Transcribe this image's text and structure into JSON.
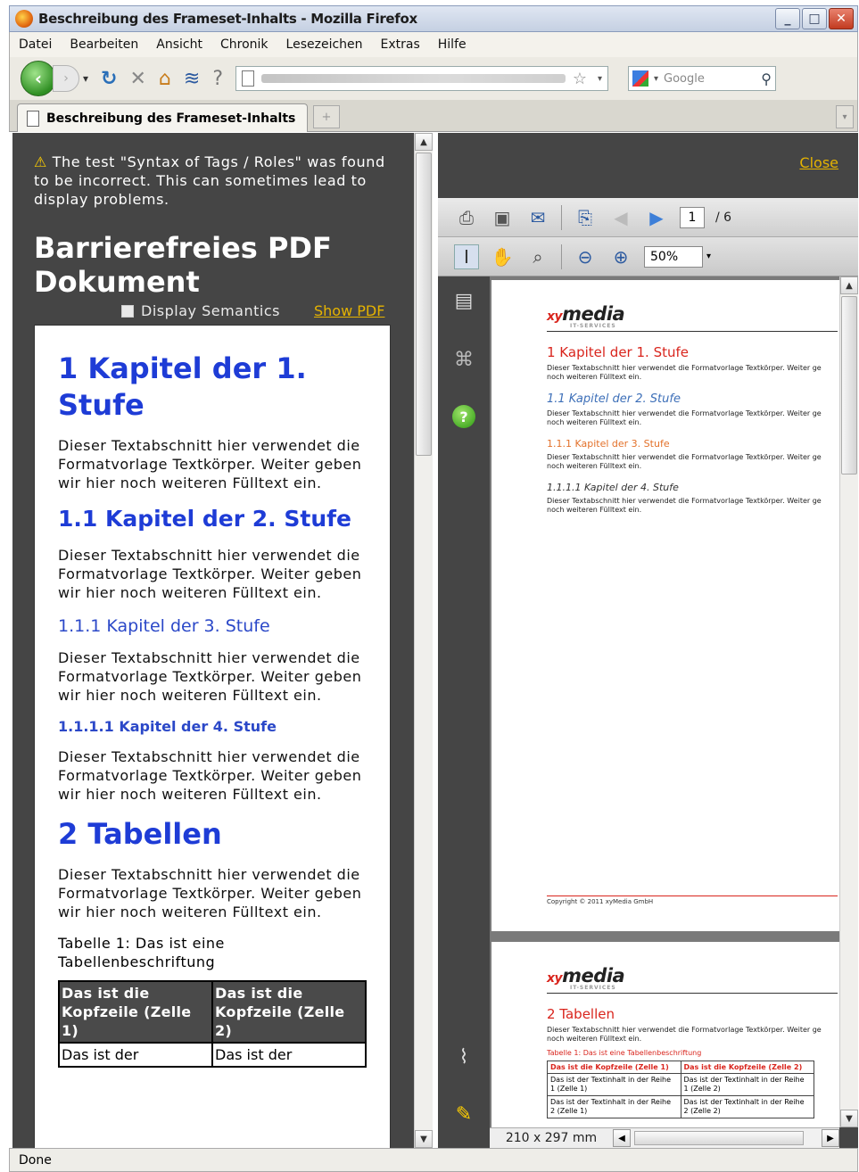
{
  "window": {
    "title": "Beschreibung des Frameset-Inhalts - Mozilla Firefox",
    "controls": [
      "_",
      "□",
      "✕"
    ]
  },
  "menu": [
    "Datei",
    "Bearbeiten",
    "Ansicht",
    "Chronik",
    "Lesezeichen",
    "Extras",
    "Hilfe"
  ],
  "navbar": {
    "search_placeholder": "Google",
    "icons": [
      "back-arrow-icon",
      "forward-arrow-icon",
      "reload-icon",
      "stop-icon",
      "home-icon",
      "rss-icon",
      "help-icon"
    ]
  },
  "tabs": [
    {
      "label": "Beschreibung des Frameset-Inhalts"
    }
  ],
  "left_frame": {
    "warning": "The test \"Syntax of Tags / Roles\" was found to be incorrect. This can sometimes lead to display problems.",
    "title": "Barrierefreies PDF Dokument",
    "display_semantics": "Display Semantics",
    "show_pdf": "Show PDF",
    "doc": {
      "h1_1": "1 Kapitel der 1. Stufe",
      "p1": "Dieser Textabschnitt hier verwendet die Formatvorlage Textkörper. Weiter geben wir hier noch weiteren Fülltext ein.",
      "h2_1": "1.1 Kapitel der 2. Stufe",
      "p2": "Dieser Textabschnitt hier verwendet die Formatvorlage Textkörper. Weiter geben wir hier noch weiteren Fülltext ein.",
      "h3_1": "1.1.1 Kapitel der 3. Stufe",
      "p3": "Dieser Textabschnitt hier verwendet die Formatvorlage Textkörper. Weiter geben wir hier noch weiteren Fülltext ein.",
      "h4_1": "1.1.1.1 Kapitel der 4. Stufe",
      "p4": "Dieser Textabschnitt hier verwendet die Formatvorlage Textkörper. Weiter geben wir hier noch weiteren Fülltext ein.",
      "h1_2": "2 Tabellen",
      "p5": "Dieser Textabschnitt hier verwendet die Formatvorlage Textkörper. Weiter geben wir hier noch weiteren Fülltext ein.",
      "caption": "Tabelle 1: Das ist eine Tabellenbeschriftung",
      "table": {
        "headers": [
          "Das ist die Kopfzeile (Zelle 1)",
          "Das ist die Kopfzeile (Zelle 2)"
        ],
        "row1": [
          "Das ist der",
          "Das ist der"
        ]
      }
    }
  },
  "right_frame": {
    "close": "Close",
    "page_current": "1",
    "page_total": "/ 6",
    "zoom": "50%",
    "page_size": "210 x 297 mm",
    "pdf": {
      "logo": "media",
      "logo_prefix": "xy",
      "logo_sub": "IT-SERVICES",
      "h1": "1  Kapitel der 1. Stufe",
      "h2": "1.1  Kapitel der 2. Stufe",
      "h3": "1.1.1  Kapitel der 3. Stufe",
      "h4": "1.1.1.1  Kapitel der 4. Stufe",
      "text": "Dieser Textabschnitt hier verwendet die Formatvorlage Textkörper. Weiter ge",
      "text2": "noch weiteren Fülltext ein.",
      "footer": "Copyright © 2011 xyMedia GmbH",
      "p2_h1": "2  Tabellen",
      "p2_caption": "Tabelle 1: Das ist eine Tabellenbeschriftung",
      "p2_th1": "Das ist die Kopfzeile (Zelle 1)",
      "p2_th2": "Das ist die Kopfzeile (Zelle 2)",
      "p2_r1c1": "Das ist der Textinhalt in der Reihe 1 (Zelle 1)",
      "p2_r1c2": "Das ist der Textinhalt in der Reihe 1 (Zelle 2)",
      "p2_r2c1": "Das ist der Textinhalt in der Reihe 2 (Zelle 1)",
      "p2_r2c2": "Das ist der Textinhalt in der Reihe 2 (Zelle 2)"
    }
  },
  "status": "Done"
}
